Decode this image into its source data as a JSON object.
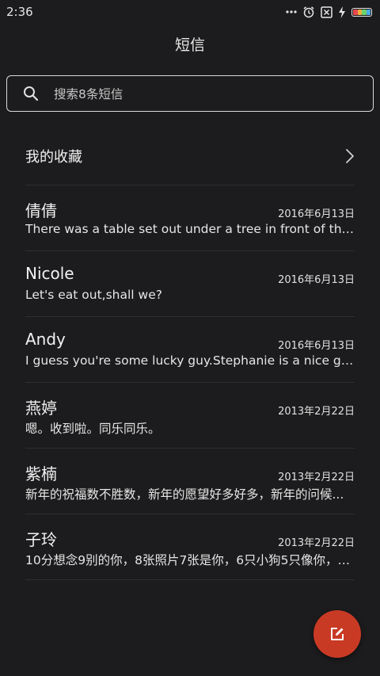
{
  "status_bar": {
    "time": "2:36",
    "icons": [
      "more-dots-icon",
      "alarm-icon",
      "sim-off-icon",
      "charging-icon",
      "battery-icon"
    ]
  },
  "header": {
    "title": "短信"
  },
  "search": {
    "placeholder": "搜索8条短信"
  },
  "favorites": {
    "label": "我的收藏"
  },
  "messages": [
    {
      "name": "倩倩",
      "date": "2016年6月13日",
      "preview": "There was a table set out under a tree in front of the ho..."
    },
    {
      "name": "Nicole",
      "date": "2016年6月13日",
      "preview": "Let's eat out,shall we?"
    },
    {
      "name": "Andy",
      "date": "2016年6月13日",
      "preview": "I guess you're some lucky guy.Stephanie is a nice girl."
    },
    {
      "name": "燕婷",
      "date": "2013年2月22日",
      "preview": "嗯。收到啦。同乐同乐。"
    },
    {
      "name": "紫楠",
      "date": "2013年2月22日",
      "preview": "新年的祝福数不胜数，新年的愿望好多好多，新年的问候..."
    },
    {
      "name": "子玲",
      "date": "2013年2月22日",
      "preview": "10分想念9别的你，8张照片7张是你，6只小狗5只像你，4..."
    }
  ],
  "colors": {
    "background": "#1c1c1e",
    "accent": "#c93a25",
    "battery_segments": [
      "#e84b4b",
      "#f0b03a",
      "#6cd36c",
      "#4aa8e8"
    ]
  }
}
